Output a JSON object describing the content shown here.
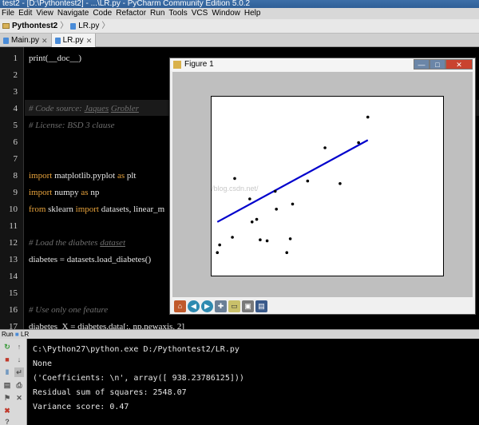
{
  "window": {
    "title": "test2 - [D:\\Pythontest2] - ...\\LR.py - PyCharm Community Edition 5.0.2"
  },
  "menu": [
    "File",
    "Edit",
    "View",
    "Navigate",
    "Code",
    "Refactor",
    "Run",
    "Tools",
    "VCS",
    "Window",
    "Help"
  ],
  "breadcrumb": {
    "project": "Pythontest2",
    "file": "LR.py"
  },
  "tabs": [
    {
      "label": "Main.py",
      "active": false
    },
    {
      "label": "LR.py",
      "active": true
    }
  ],
  "editor": {
    "line_numbers": [
      "1",
      "2",
      "3",
      "4",
      "5",
      "6",
      "7",
      "8",
      "9",
      "10",
      "11",
      "12",
      "13",
      "14",
      "15",
      "16",
      "17"
    ],
    "code": {
      "l1": "print(__doc__)",
      "l4_prefix": "# Code source: ",
      "l4_author1": "Jaques",
      "l4_author2": "Grobler",
      "l5": "# License: BSD 3 clause",
      "l8_kw1": "import",
      "l8_mod": " matplotlib.pyplot ",
      "l8_kw2": "as",
      "l8_alias": " plt",
      "l9_kw1": "import",
      "l9_mod": " numpy ",
      "l9_kw2": "as",
      "l9_alias": " np",
      "l10_kw1": "from",
      "l10_mod": " sklearn ",
      "l10_kw2": "import",
      "l10_rest": " datasets, linear_m",
      "l12_prefix": "# Load the diabetes ",
      "l12_word": "dataset",
      "l13": "diabetes = datasets.load_diabetes()",
      "l16": "# Use only one feature",
      "l17": "diabetes_X = diabetes.data[:, np.newaxis, 2]"
    }
  },
  "figure": {
    "title": "Figure 1",
    "controls": {
      "minimize": "—",
      "maximize": "□",
      "close": "✕"
    },
    "watermark": "http://blog.csdn.net/",
    "toolbar_icons": [
      "home-icon",
      "back-icon",
      "forward-icon",
      "pan-icon",
      "zoom-icon",
      "configure-icon",
      "save-icon"
    ]
  },
  "chart_data": {
    "type": "scatter",
    "x_range": [
      -0.08,
      0.12
    ],
    "y_range": [
      0,
      350
    ],
    "points": [
      [
        -0.075,
        45
      ],
      [
        -0.073,
        60
      ],
      [
        -0.062,
        75
      ],
      [
        -0.06,
        190
      ],
      [
        -0.047,
        150
      ],
      [
        -0.045,
        105
      ],
      [
        -0.041,
        110
      ],
      [
        -0.038,
        70
      ],
      [
        -0.032,
        68
      ],
      [
        -0.025,
        165
      ],
      [
        -0.024,
        130
      ],
      [
        -0.015,
        45
      ],
      [
        -0.012,
        72
      ],
      [
        -0.01,
        140
      ],
      [
        0.003,
        185
      ],
      [
        0.018,
        250
      ],
      [
        0.031,
        180
      ],
      [
        0.047,
        260
      ],
      [
        0.055,
        310
      ]
    ],
    "regression_line": {
      "x": [
        -0.075,
        0.055
      ],
      "y": [
        105,
        265
      ],
      "color": "#0000cc"
    },
    "point_color": "#000000",
    "axes_visible": false,
    "grid": false
  },
  "run": {
    "header": "Run",
    "config": "LR",
    "output": [
      "C:\\Python27\\python.exe D:/Pythontest2/LR.py",
      "None",
      "('Coefficients: \\n', array([ 938.23786125]))",
      "Residual sum of squares: 2548.07",
      "Variance score: 0.47"
    ]
  }
}
